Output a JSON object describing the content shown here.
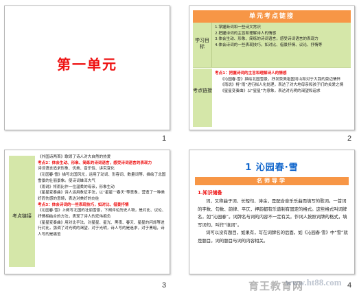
{
  "slides": [
    {
      "number": "1",
      "title": "第一单元"
    },
    {
      "number": "2",
      "header": "单元考点链接",
      "row1_label": "学习目标",
      "row1_lines": [
        "1.掌握新词和一些诗文常识",
        "2.把握诗词的主旨和理解诗人的情感",
        "3.体会生动、形象、简练的诗词语言，感受诗词语言的表现力",
        "4.体会诗词的一些表现技巧，如对比、借景抒情、议论、抒情等"
      ],
      "row2_label": "考点链接",
      "row2_lead": "考点1：把握诗词的主旨和理解诗人的情感",
      "row2_lines": [
        "《沁园春·雪》描绘北国雪景，抒发赞美祖国河山和对于大我的豪迈情怀",
        "《雨说》将“雨”进行拟人化处理，表达了对大地母亲和孩子们的关爱之情",
        "《星星变奏曲》以“星星”为意象，表达对光明的渴望和追求"
      ]
    },
    {
      "number": "3",
      "side_label": "考点链接",
      "lines": [
        "《外国诗两首》歌颂了诗人对大自然的热爱",
        "考点2：体会生动、形象、简练的诗词语言，感受诗词语言的表现力",
        "诗词语言追求形象、优美、音乐性、讲究变化",
        "《沁园春·雪》描写北国风光，运用了动词、形容词、数量词等，描绘了北国雪景的壮丽景象。使诗词雄浑大气",
        "《雨说》将雨比作一位温柔的母亲，形象生动",
        "《星星变奏曲》诗人运用象征手法，以“星星”“春天”等意象，营造了一种美好而伤感的意境，表达对美好的向往",
        "考点3：体会诗词的一些表现技巧，如对比、借景抒情",
        "《沁园春·雪》上阕写北国的壮丽雪景，下阕评论历史人物，是对比、议论、抒情相结合的方法，表现了诗人的宏伟抱负",
        "《星星变奏曲》用对比手法，对星星、星光、黑夜、春天、星星的闪烁等进行对比，强调了对光明的渴望。对于光明，诗人写的是追求，对于黑暗，诗人写的是痛苦"
      ]
    },
    {
      "number": "4",
      "title": "1  沁园春·雪",
      "band": "名师导学",
      "sub": "1.知识储备",
      "paras": [
        "词，又称曲子词、长短句、诗余，是配合音乐乐曲而填写的歌词。一首词的字数、句数、韵律、平仄，押韵都有乐谱制有固定的格式。这些格式叫词牌名，如“沁园春”。词牌名与词的内容不一定有关，作词人按照词牌的格式，填写词句，叫作“填词”。",
        "词可以没有题目，如果有，写在词牌名的后面，如《沁园春·雪》中“雪”就是题目。词的题目与词的内容相关。"
      ]
    }
  ],
  "watermark": {
    "text": "育王教育网",
    "url": "www.ht88.com"
  }
}
